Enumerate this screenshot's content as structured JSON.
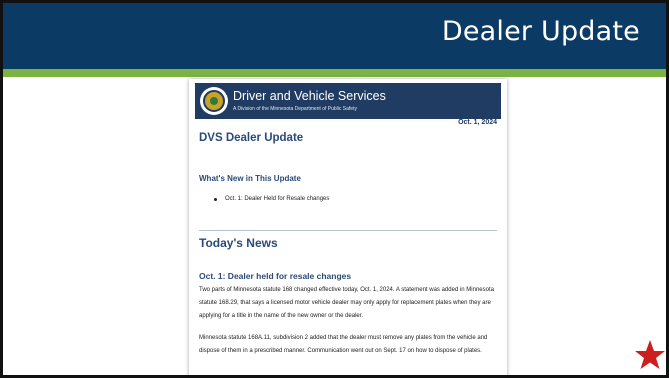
{
  "slide": {
    "title": "Dealer Update"
  },
  "newsletter": {
    "org_name": "Driver and Vehicle Services",
    "org_subtitle": "A Division of the Minnesota Department of Public Safety",
    "date": "Oct. 1, 2024",
    "title": "DVS Dealer Update",
    "whats_new_heading": "What's New in This Update",
    "whats_new_items": [
      "Oct. 1: Dealer Held for Resale changes"
    ],
    "todays_news_heading": "Today's News",
    "article": {
      "heading": "Oct. 1: Dealer held for resale changes",
      "paragraphs": [
        "Two parts of Minnesota statute 168 changed effective today, Oct. 1, 2024.  A statement was added in Minnesota statute 168.29, that says a licensed motor vehicle dealer may only apply for replacement plates when they are applying for a title in the name of the new owner or the dealer.",
        "Minnesota statute 168A.11, subdivision 2 added that the dealer must remove any plates from the vehicle and dispose of them in a prescribed manner. Communication went out on Sept. 17 on how to dispose of plates."
      ]
    }
  },
  "colors": {
    "header_navy": "#0b3a64",
    "accent_green": "#7cb342",
    "banner_navy": "#213c63",
    "heading_blue": "#2b4a78",
    "star_red": "#cc1f1f"
  },
  "icons": {
    "seal": "minnesota-seal-icon",
    "star": "star-icon"
  }
}
